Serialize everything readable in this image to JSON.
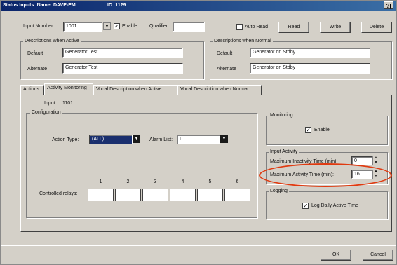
{
  "window": {
    "title": "Status Inputs: Name: DAVE-EM",
    "id_label": "ID: 1129",
    "help_glyph": "?|"
  },
  "top": {
    "input_number_label": "Input Number",
    "input_number_value": "1001",
    "enable_label": "Enable",
    "enable_checked": true,
    "qualifier_label": "Qualifier",
    "qualifier_value": "",
    "auto_read_label": "Auto Read",
    "auto_read_checked": false,
    "read_label": "Read",
    "write_label": "Write",
    "delete_label": "Delete"
  },
  "desc_active": {
    "title": "Descriptions when Active",
    "default_label": "Default",
    "default_value": "Generator Test",
    "alternate_label": "Alternate",
    "alternate_value": "Generator Test"
  },
  "desc_normal": {
    "title": "Descriptions when Normal",
    "default_label": "Default",
    "default_value": "Generator on Stdby",
    "alternate_label": "Alternate",
    "alternate_value": "Generator on Stdby"
  },
  "tabs": [
    {
      "label": "Actions"
    },
    {
      "label": "Activity Monitoring"
    },
    {
      "label": "Vocal Description when Active"
    },
    {
      "label": "Vocal Description when Normal"
    }
  ],
  "activity": {
    "input_label": "Input:",
    "input_value": "1101",
    "configuration_title": "Configuration",
    "action_type_label": "Action Type:",
    "action_type_value": "(ALL)",
    "alarm_list_label": "Alarm List:",
    "alarm_list_value": "I",
    "controlled_relays_label": "Controlled relays:",
    "relay_numbers": [
      "1",
      "2",
      "3",
      "4",
      "5",
      "6"
    ],
    "monitoring_title": "Monitoring",
    "monitoring_enable_label": "Enable",
    "input_activity_title": "Input Activity",
    "max_inactivity_label": "Maximum Inactivity Time (min):",
    "max_inactivity_value": "0",
    "max_activity_label": "Maximum Activity Time (min):",
    "max_activity_value": "16",
    "logging_title": "Logging",
    "log_daily_label": "Log Daily Active Time"
  },
  "footer": {
    "ok_label": "OK",
    "cancel_label": "Cancel"
  },
  "colors": {
    "title_bar": "#0a246a",
    "highlight_circle": "#e03a10"
  }
}
